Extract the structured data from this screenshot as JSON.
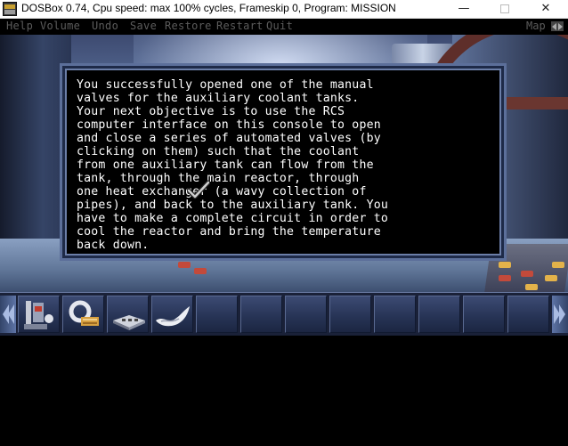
{
  "window": {
    "title": "DOSBox 0.74, Cpu speed: max 100% cycles, Frameskip  0, Program:  MISSION",
    "minimize_glyph": "—",
    "close_glyph": "✕"
  },
  "menu": {
    "items": [
      "Help",
      "Volume",
      "Undo",
      "Save",
      "Restore",
      "Restart",
      "Quit"
    ],
    "map_label": "Map"
  },
  "dialog": {
    "lines": [
      "You successfully opened one of the manual",
      "valves for the auxiliary coolant tanks.",
      "Your next objective is to use the RCS",
      "computer interface on this console to open",
      "and close a series of automated valves (by",
      "clicking on them) such that the coolant",
      "from one auxiliary tank can flow from the",
      "tank, through the main reactor, through",
      "one heat exchanger (a wavy collection of",
      "pipes), and back to the auxiliary tank. You",
      "have to make a complete circuit in order to",
      "cool the reactor and bring the temperature",
      "back down."
    ]
  },
  "inventory": {
    "slots": [
      {
        "item": "valve-tool-icon"
      },
      {
        "item": "wrench-icon"
      },
      {
        "item": "keypad-device-icon"
      },
      {
        "item": "rag-icon"
      },
      {
        "item": ""
      },
      {
        "item": ""
      },
      {
        "item": ""
      },
      {
        "item": ""
      },
      {
        "item": ""
      },
      {
        "item": ""
      },
      {
        "item": ""
      },
      {
        "item": ""
      }
    ]
  },
  "colors": {
    "dialog_border": "#5c6f9a",
    "dialog_text": "#ffffff",
    "menu_text": "#5c5c5c"
  }
}
